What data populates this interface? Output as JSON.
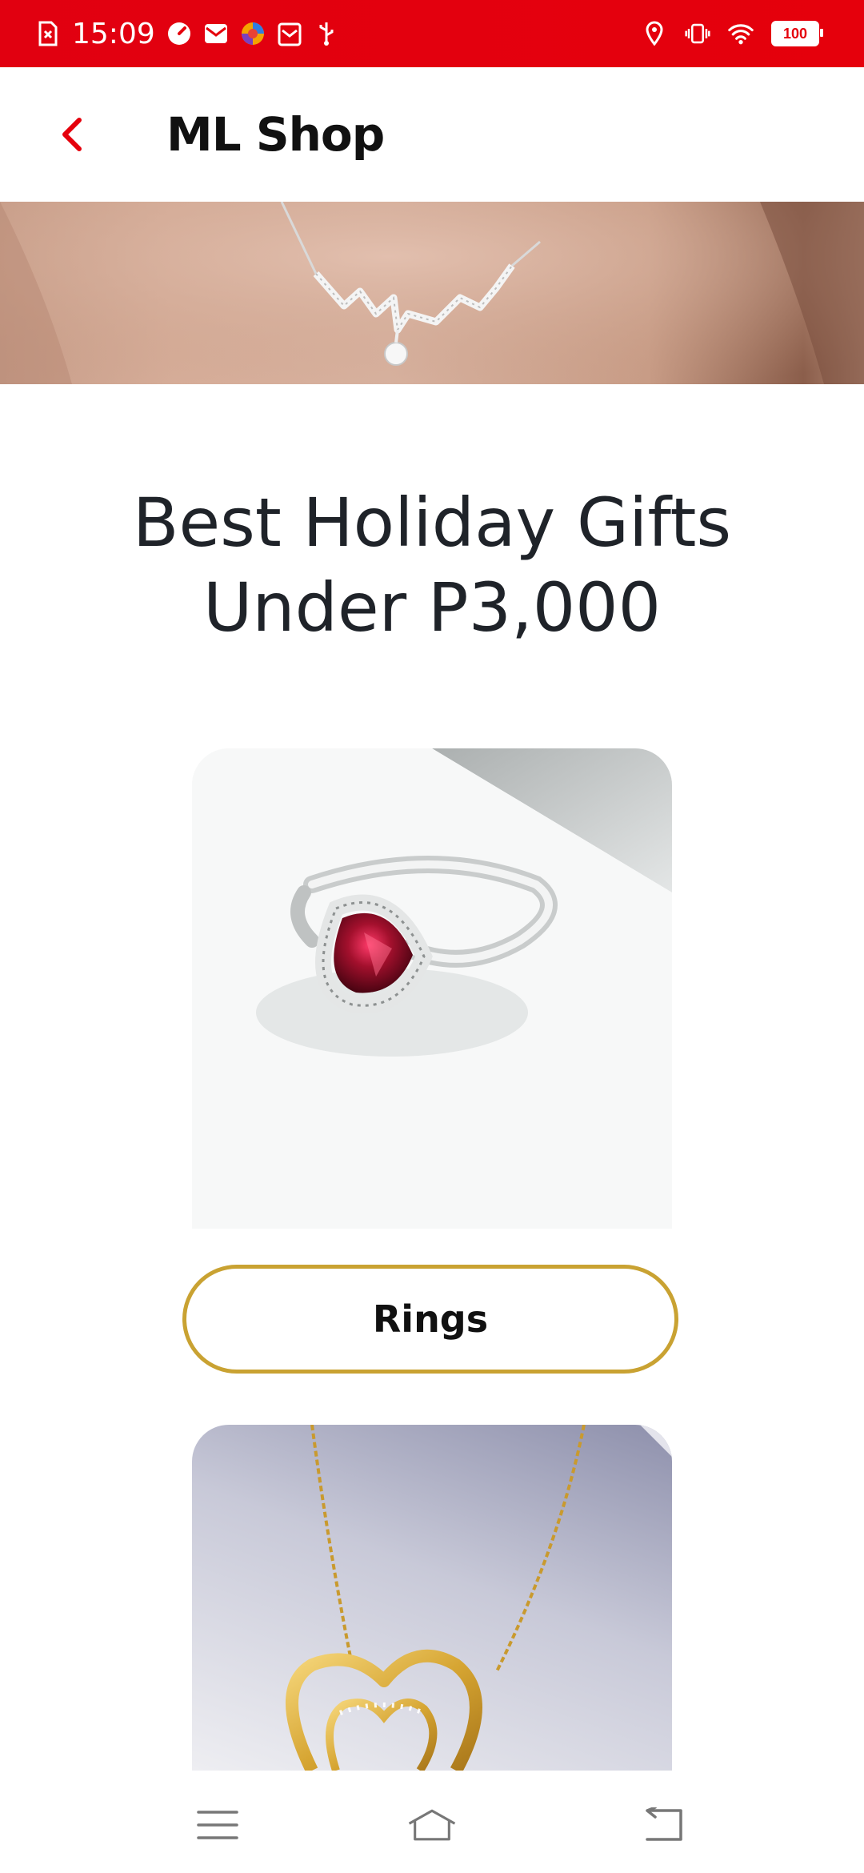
{
  "status_bar": {
    "time": "15:09",
    "battery": "100",
    "left_icons": [
      "sim-card-icon",
      "speedometer-icon",
      "mail-icon",
      "browser-icon",
      "calendar-mail-icon",
      "usb-icon"
    ],
    "right_icons": [
      "location-icon",
      "vibrate-icon",
      "wifi-icon",
      "battery-icon"
    ]
  },
  "header": {
    "title": "ML Shop",
    "back_icon": "chevron-left-icon",
    "accent_color": "#e5000c"
  },
  "content": {
    "heading": "Best Holiday Gifts Under P3,000",
    "categories": [
      {
        "label": "Rings",
        "image": "ruby-ring-image"
      },
      {
        "label": "",
        "image": "gold-heart-necklace-image"
      }
    ],
    "button_border_color": "#c9a232"
  },
  "nav_bar": {
    "items": [
      "menu-icon",
      "home-icon",
      "back-icon"
    ]
  }
}
